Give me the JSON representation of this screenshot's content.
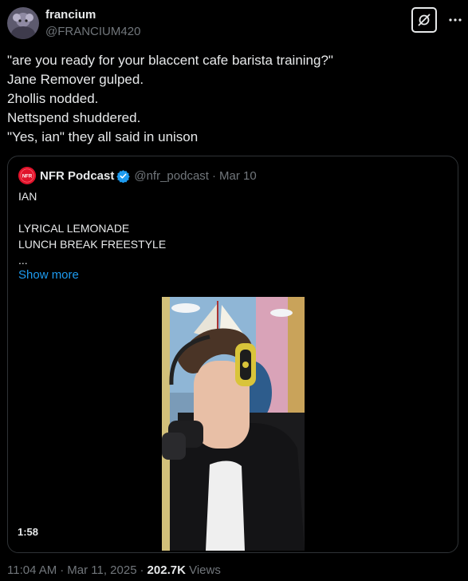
{
  "author": {
    "name": "francium",
    "handle": "@FRANCIUM420"
  },
  "tweet": {
    "lines": [
      "\"are you ready for your blaccent cafe barista training?\"",
      "Jane Remover gulped.",
      "2hollis nodded.",
      "Nettspend shuddered.",
      "\"Yes, ian\" they all said in unison"
    ]
  },
  "quote": {
    "name": "NFR Podcast",
    "handle": "@nfr_podcast",
    "separator": "·",
    "date": "Mar 10",
    "text_lines": [
      "IAN",
      "",
      "LYRICAL LEMONADE",
      "LUNCH BREAK FREESTYLE",
      "..."
    ],
    "show_more": "Show more",
    "video_duration": "1:58",
    "avatar_text": "NFR"
  },
  "meta": {
    "time": "11:04 AM",
    "dot1": "·",
    "date": "Mar 11, 2025",
    "dot2": "·",
    "views_count": "202.7K",
    "views_label": "Views"
  },
  "icons": {
    "grok": "grok-icon",
    "more": "more-icon",
    "verified": "verified-badge-icon"
  },
  "colors": {
    "background": "#000000",
    "text": "#e7e9ea",
    "secondary": "#71767b",
    "link": "#1d9bf0",
    "border": "#2f3336",
    "verified": "#1d9bf0"
  }
}
